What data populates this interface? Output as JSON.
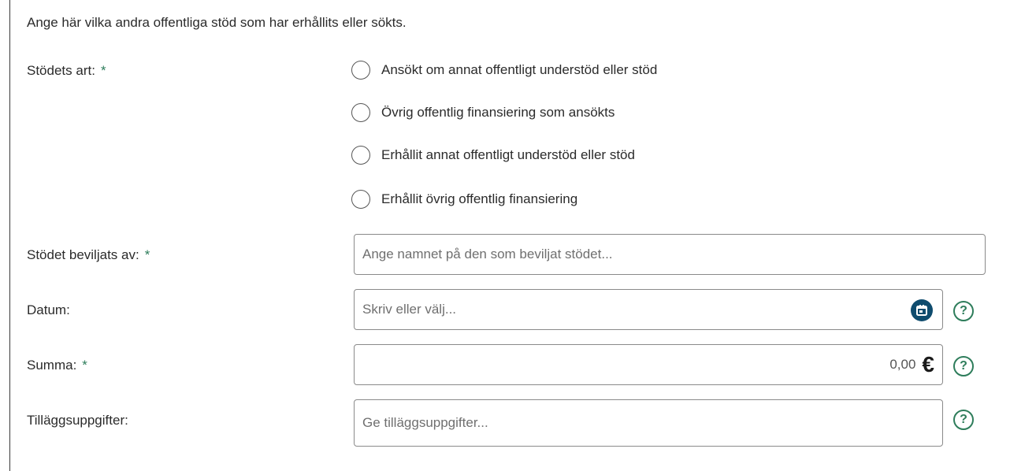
{
  "intro_text": "Ange här vilka andra offentliga stöd som har erhållits eller sökts.",
  "required_marker": "*",
  "support_type": {
    "label": "Stödets art:",
    "options": [
      "Ansökt om annat offentligt understöd eller stöd",
      "Övrig offentlig finansiering som ansökts",
      "Erhållit annat offentligt understöd eller stöd",
      "Erhållit övrig offentlig finansiering"
    ]
  },
  "granted_by": {
    "label": "Stödet beviljats av:",
    "placeholder": "Ange namnet på den som beviljat stödet..."
  },
  "date": {
    "label": "Datum:",
    "placeholder": "Skriv eller välj...",
    "icon": "calendar-icon"
  },
  "amount": {
    "label": "Summa:",
    "value": "0,00",
    "currency": "€"
  },
  "additional_info": {
    "label": "Tilläggsuppgifter:",
    "placeholder": "Ge tilläggsuppgifter..."
  },
  "help_icon": "?",
  "colors": {
    "accent_green": "#2e7d5b",
    "calendar_blue": "#0f4c6e",
    "border": "#8a8a8a"
  }
}
